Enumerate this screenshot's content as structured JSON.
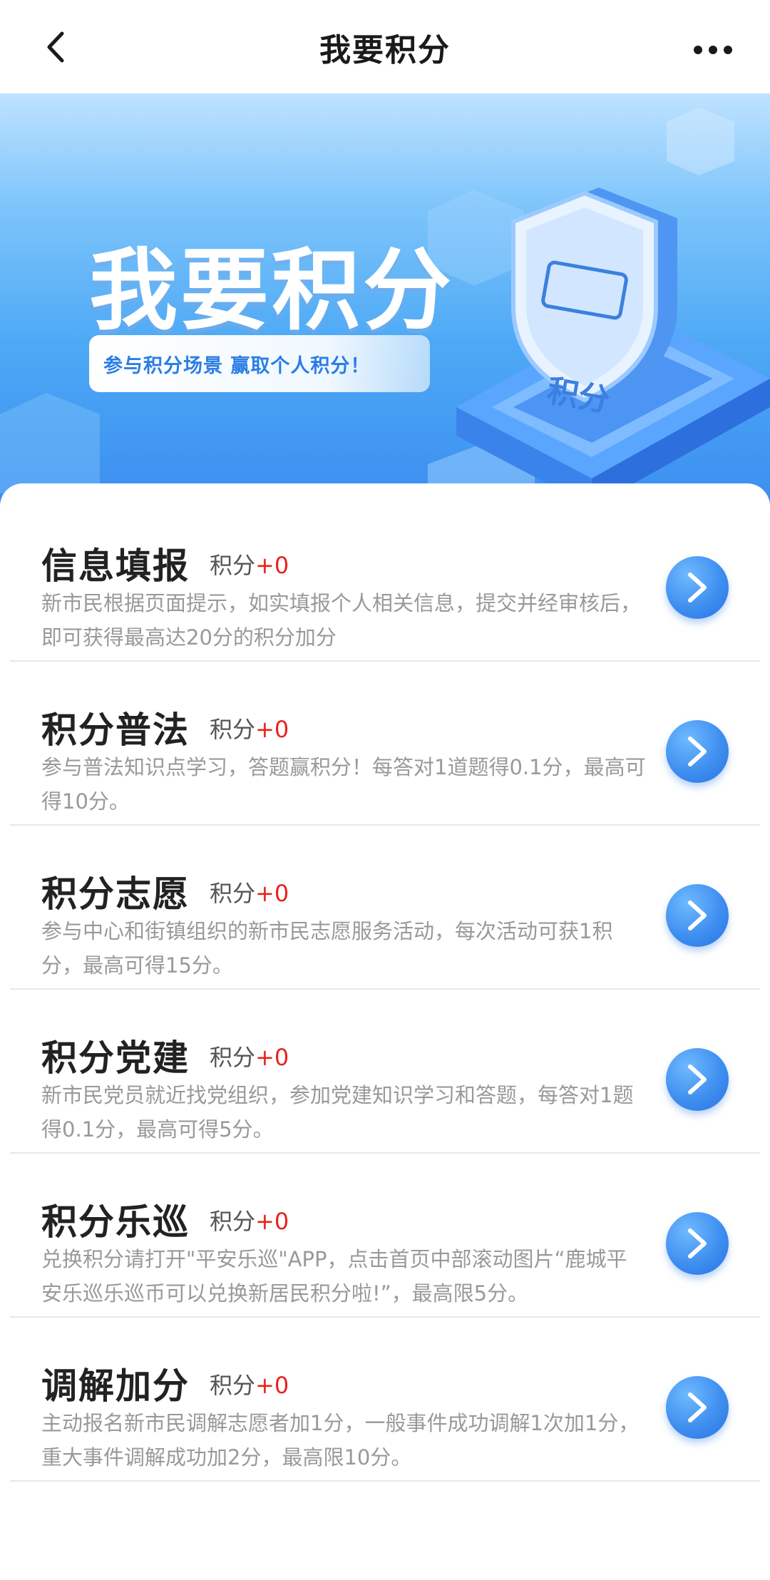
{
  "header": {
    "title": "我要积分",
    "back_icon": "chevron-left-icon",
    "more_icon": "more-dots-icon"
  },
  "banner": {
    "title": "我要积分",
    "subtitle": "参与积分场景 赢取个人积分！",
    "badge_text": "积分"
  },
  "score_prefix": "积分",
  "items": [
    {
      "title": "信息填报",
      "score": "+0",
      "desc": "新市民根据页面提示，如实填报个人相关信息，提交并经审核后，即可获得最高达20分的积分加分"
    },
    {
      "title": "积分普法",
      "score": "+0",
      "desc": "参与普法知识点学习，答题赢积分！每答对1道题得0.1分，最高可得10分。"
    },
    {
      "title": "积分志愿",
      "score": "+0",
      "desc": "参与中心和街镇组织的新市民志愿服务活动，每次活动可获1积分，最高可得15分。"
    },
    {
      "title": "积分党建",
      "score": "+0",
      "desc": "新市民党员就近找党组织，参加党建知识学习和答题，每答对1题得0.1分，最高可得5分。"
    },
    {
      "title": "积分乐巡",
      "score": "+0",
      "desc": "兑换积分请打开\"平安乐巡\"APP，点击首页中部滚动图片“鹿城平安乐巡乐巡币可以兑换新居民积分啦!”，最高限5分。"
    },
    {
      "title": "调解加分",
      "score": "+0",
      "desc": "主动报名新市民调解志愿者加1分，一般事件成功调解1次加1分，重大事件调解成功加2分，最高限10分。"
    }
  ],
  "colors": {
    "accent": "#3f8ff0",
    "score_plus": "#e8231e",
    "desc": "#999999",
    "title": "#222222"
  }
}
